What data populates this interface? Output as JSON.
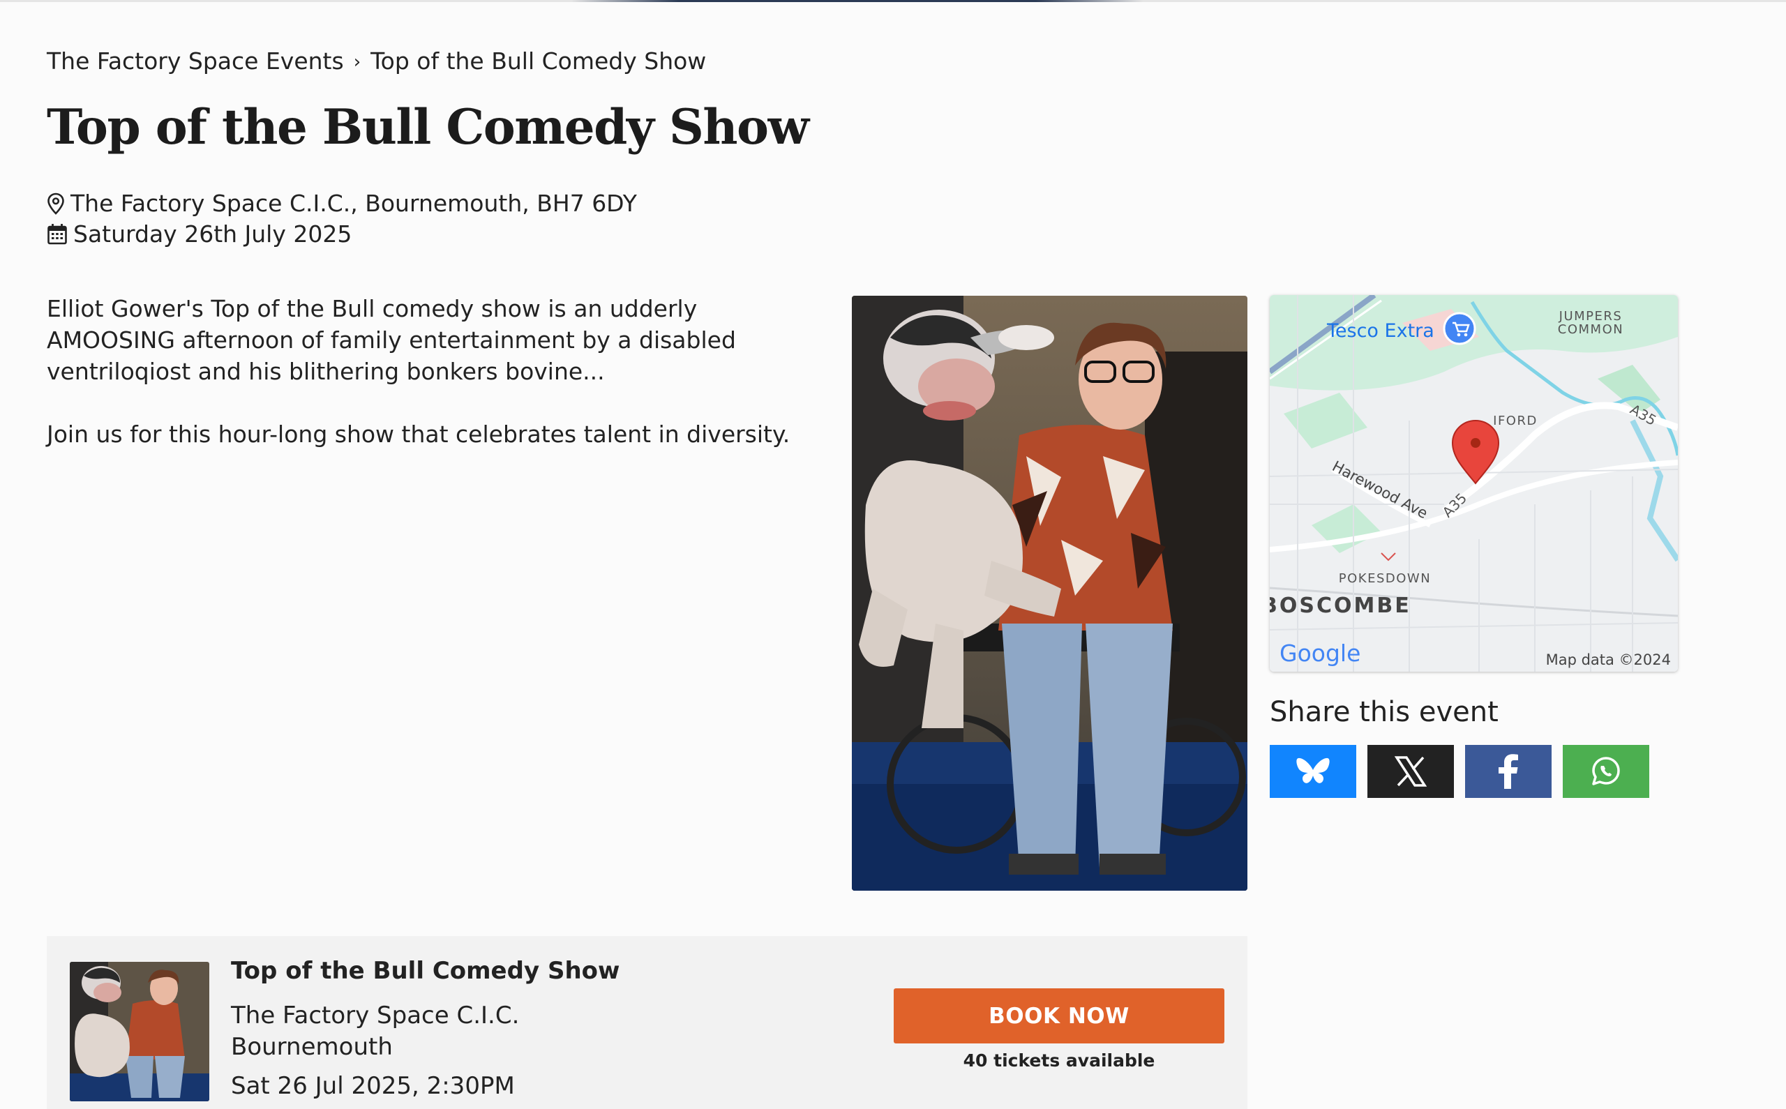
{
  "breadcrumb": {
    "parent": "The Factory Space Events",
    "separator": "›",
    "current": "Top of the Bull Comedy Show"
  },
  "event": {
    "title": "Top of the Bull Comedy Show",
    "location": "The Factory Space C.I.C., Bournemouth, BH7 6DY",
    "date": "Saturday 26th July 2025",
    "description": [
      "Elliot Gower's Top of the Bull comedy show is an udderly AMOOSING afternoon of family entertainment by a disabled ventriloqiost and his blithering bonkers bovine...",
      "Join us for this hour-long show that celebrates talent in diversity."
    ]
  },
  "map": {
    "labels": {
      "tesco": "Tesco Extra",
      "jumpers_1": "JUMPERS",
      "jumpers_2": "COMMON",
      "iford": "IFORD",
      "a35_top": "A35",
      "harewood": "Harewood Ave",
      "a35_mid": "A35",
      "pokesdown": "POKESDOWN",
      "boscombe": "BOSCOMBE",
      "google": "Google",
      "attribution": "Map data ©2024"
    }
  },
  "share": {
    "heading": "Share this event",
    "buttons": [
      {
        "name": "bluesky",
        "icon": "bluesky-butterfly-icon",
        "color": "#1185fe"
      },
      {
        "name": "x",
        "icon": "x-logo-icon",
        "color": "#222222"
      },
      {
        "name": "facebook",
        "icon": "facebook-f-icon",
        "color": "#3b5998"
      },
      {
        "name": "whatsapp",
        "icon": "whatsapp-icon",
        "color": "#4caf50"
      }
    ]
  },
  "booking": {
    "title": "Top of the Bull Comedy Show",
    "venue_line1": "The Factory Space C.I.C.",
    "venue_line2": "Bournemouth",
    "datetime": "Sat 26 Jul 2025, 2:30PM",
    "button_label": "BOOK NOW",
    "tickets_available": "40 tickets available",
    "button_color": "#e0622a"
  }
}
